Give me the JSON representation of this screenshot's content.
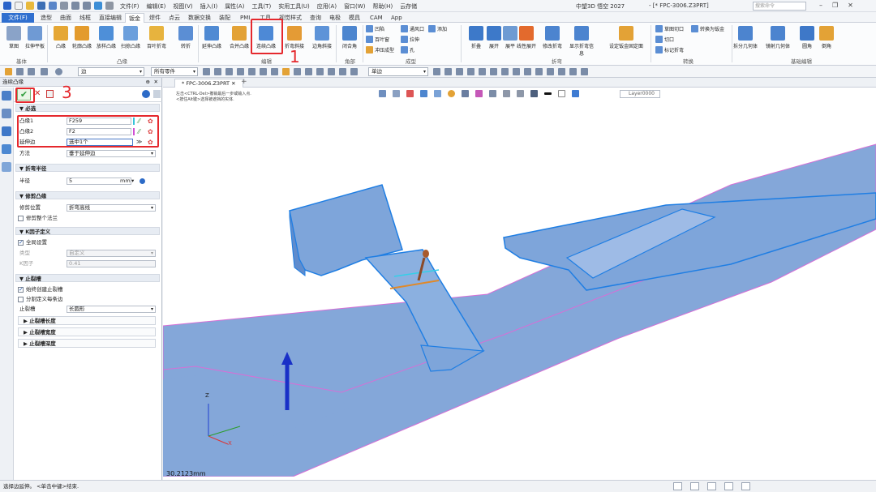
{
  "titlebar": {
    "menus": [
      "文件(F)",
      "编辑(E)",
      "视图(V)",
      "插入(I)",
      "属性(A)",
      "工具(T)",
      "实用工具(U)",
      "应用(A)",
      "窗口(W)",
      "帮助(H)",
      "云存储"
    ],
    "app_title": "中望3D 悟空 2027",
    "doc_title": "- [* FPC-3006.Z3PRT]",
    "search_placeholder": "搜索命令"
  },
  "ribbon_tabs": [
    "文件(F)",
    "造型",
    "曲面",
    "线框",
    "直接编辑",
    "钣金",
    "焊件",
    "点云",
    "数据交换",
    "装配",
    "PMI",
    "工具",
    "视觉样式",
    "查询",
    "电极",
    "模具",
    "CAM",
    "App"
  ],
  "ribbon": {
    "buttons": [
      "草图",
      "拉伸平板",
      "凸缘",
      "轮廓凸缘",
      "放样凸缘",
      "扫掠凸缘",
      "百叶折弯",
      "转折",
      "延伸凸缘",
      "合并凸缘",
      "连续凸缘",
      "折弯斜接",
      "边角斜接",
      "闭合角",
      "折叠",
      "展开",
      "展平",
      "线性展开",
      "修改折弯",
      "显示折弯信息",
      "设定钣金固定面",
      "拆分几何体",
      "镜射几何体",
      "圆角",
      "倒角"
    ],
    "small_buttons": [
      "凹陷",
      "通风口",
      "百叶窗",
      "拉伸",
      "冲压成型",
      "孔",
      "添加",
      "草图切口",
      "切口",
      "标记折弯",
      "转换为钣金"
    ],
    "groups": [
      "基体",
      "凸缘",
      "编辑",
      "角部",
      "成型",
      "折弯",
      "转换",
      "基础编辑"
    ],
    "selected_combo": "边",
    "filter_combo": "所有零件",
    "single_edge_combo": "单边"
  },
  "panel": {
    "title": "连续凸缘",
    "sections": {
      "required": "必选",
      "bend_radius": "折弯半径",
      "bend_relief": "修剪凸缘",
      "k_factor": "K因子定义",
      "relief": "止裂槽"
    },
    "rows": {
      "flange1_label": "凸缘1",
      "flange1_value": "F259",
      "flange2_label": "凸缘2",
      "flange2_value": "F2",
      "extend_edge_label": "延伸边",
      "extend_edge_value": "选中1个",
      "method_label": "方法",
      "method_value": "垂于延伸边",
      "radius_label": "半径",
      "radius_value": "5",
      "radius_unit": "mm",
      "trim_pos_label": "修剪位置",
      "trim_pos_value": "折弯高线",
      "trim_all_label": "修剪整个法兰",
      "global_default_label": "全局设置",
      "type_label": "类型",
      "type_value": "自定义",
      "kfactor_label": "K因子",
      "kfactor_value": "0.41",
      "relief_auto_label": "始终创建止裂槽",
      "relief_each_label": "分割定义每条边",
      "relief_type_label": "止裂槽",
      "relief_type_value": "长圆形",
      "relief_len": "止裂槽长度",
      "relief_width": "止裂槽宽度",
      "relief_depth": "止裂槽深度"
    }
  },
  "viewport": {
    "tab": "* FPC-3006.Z3PRT",
    "hint_line1": "左击<CTRL-Del>撤销最后一步或输入点.",
    "hint_line2": "<按住Alt键>选择被遮挡的实体.",
    "layer": "Layer0000",
    "measure": "30.2123mm"
  },
  "annotations": [
    "1",
    "2",
    "3"
  ],
  "status": {
    "text": "选择边延伸。 <单击中键>结束."
  },
  "colors": {
    "accent": "#2f6fcf",
    "part_fill": "#7fa6d8",
    "part_edge": "#1f7ee3",
    "highlight_red": "#e5282d",
    "axis_z": "#1930c7"
  }
}
